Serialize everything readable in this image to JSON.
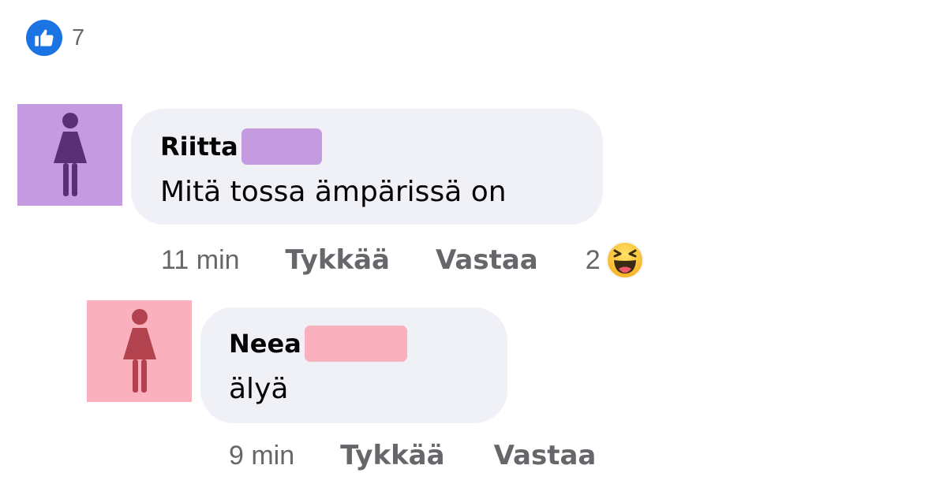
{
  "post": {
    "like_count": "7",
    "like_icon": "like-icon"
  },
  "comments": [
    {
      "author": "Riitta",
      "text": "Mitä tossa ämpärissä on",
      "time": "11 min",
      "like_label": "Tykkää",
      "reply_label": "Vastaa",
      "reaction_count": "2",
      "reaction_icon": "haha-icon",
      "avatar_color": "#c49ae1",
      "avatar_figure_color": "#5a2f74"
    },
    {
      "author": "Neea",
      "text": "älyä",
      "time": "9 min",
      "like_label": "Tykkää",
      "reply_label": "Vastaa",
      "avatar_color": "#fbb1bd",
      "avatar_figure_color": "#b3424f"
    }
  ],
  "colors": {
    "bubble": "#f0f1f6",
    "meta_text": "#65676b",
    "like_blue": "#1b74e4"
  }
}
